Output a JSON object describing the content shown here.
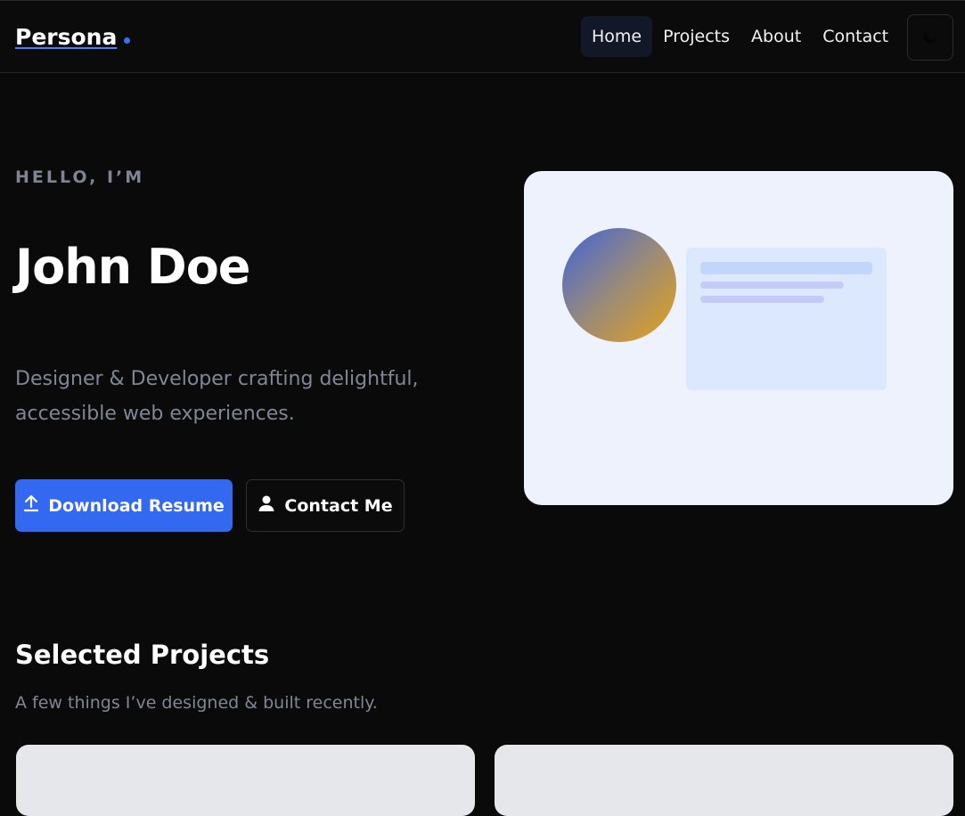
{
  "brand": {
    "name": "Persona"
  },
  "nav": {
    "items": [
      {
        "label": "Home",
        "active": true
      },
      {
        "label": "Projects",
        "active": false
      },
      {
        "label": "About",
        "active": false
      },
      {
        "label": "Contact",
        "active": false
      }
    ],
    "theme_toggle_icon": "moon-icon"
  },
  "hero": {
    "eyebrow": "HELLO, I’M",
    "name": "John Doe",
    "description": "Designer & Developer crafting delightful, accessible web experiences.",
    "primary_button": {
      "label": "Download Resume",
      "icon": "upload-icon"
    },
    "secondary_button": {
      "label": "Contact Me",
      "icon": "user-icon"
    }
  },
  "projects": {
    "title": "Selected Projects",
    "subtitle": "A few things I’ve designed & built recently."
  },
  "colors": {
    "accent": "#3369f0",
    "background": "#0a0a0b",
    "muted_text": "#7f8696",
    "card_bg": "#eef2fd"
  }
}
